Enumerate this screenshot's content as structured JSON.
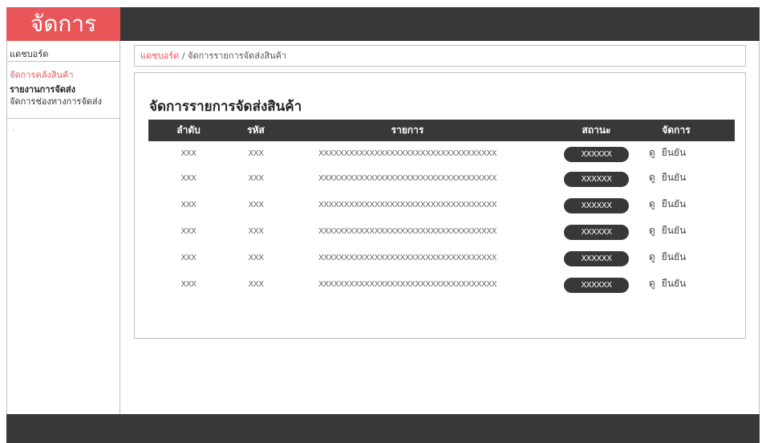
{
  "app": {
    "logo_title": "จัดการ"
  },
  "sidebar": {
    "items": [
      {
        "label": "แดชบอร์ด"
      },
      {
        "label": "จัดการคลังสินค้า"
      },
      {
        "label": "รายงานการจัดส่ง"
      },
      {
        "label": "จัดการช่องทางการจัดส่ง"
      }
    ]
  },
  "breadcrumb": {
    "home": "แดชบอร์ด",
    "separator": " / ",
    "current": "จัดการรายการจัดส่งสินค้า"
  },
  "panel": {
    "title": "จัดการรายการจัดส่งสินค้า",
    "columns": [
      "ลำดับ",
      "รหัส",
      "รายการ",
      "สถานะ",
      "จัดการ"
    ],
    "rows": [
      {
        "order": "XXX",
        "code": "XXX",
        "item": "XXXXXXXXXXXXXXXXXXXXXXXXXXXXXXXXXXX",
        "status": "XXXXXX",
        "view": "ดู",
        "confirm": "ยืนยัน"
      },
      {
        "order": "XXX",
        "code": "XXX",
        "item": "XXXXXXXXXXXXXXXXXXXXXXXXXXXXXXXXXXX",
        "status": "XXXXXX",
        "view": "ดู",
        "confirm": "ยืนยัน"
      },
      {
        "order": "XXX",
        "code": "XXX",
        "item": "XXXXXXXXXXXXXXXXXXXXXXXXXXXXXXXXXXX",
        "status": "XXXXXX",
        "view": "ดู",
        "confirm": "ยืนยัน"
      },
      {
        "order": "XXX",
        "code": "XXX",
        "item": "XXXXXXXXXXXXXXXXXXXXXXXXXXXXXXXXXXX",
        "status": "XXXXXX",
        "view": "ดู",
        "confirm": "ยืนยัน"
      },
      {
        "order": "XXX",
        "code": "XXX",
        "item": "XXXXXXXXXXXXXXXXXXXXXXXXXXXXXXXXXXX",
        "status": "XXXXXX",
        "view": "ดู",
        "confirm": "ยืนยัน"
      },
      {
        "order": "XXX",
        "code": "XXX",
        "item": "XXXXXXXXXXXXXXXXXXXXXXXXXXXXXXXXXXX",
        "status": "XXXXXX",
        "view": "ดู",
        "confirm": "ยืนยัน"
      }
    ]
  },
  "colors": {
    "accent": "#e9565a",
    "dark": "#383838"
  }
}
